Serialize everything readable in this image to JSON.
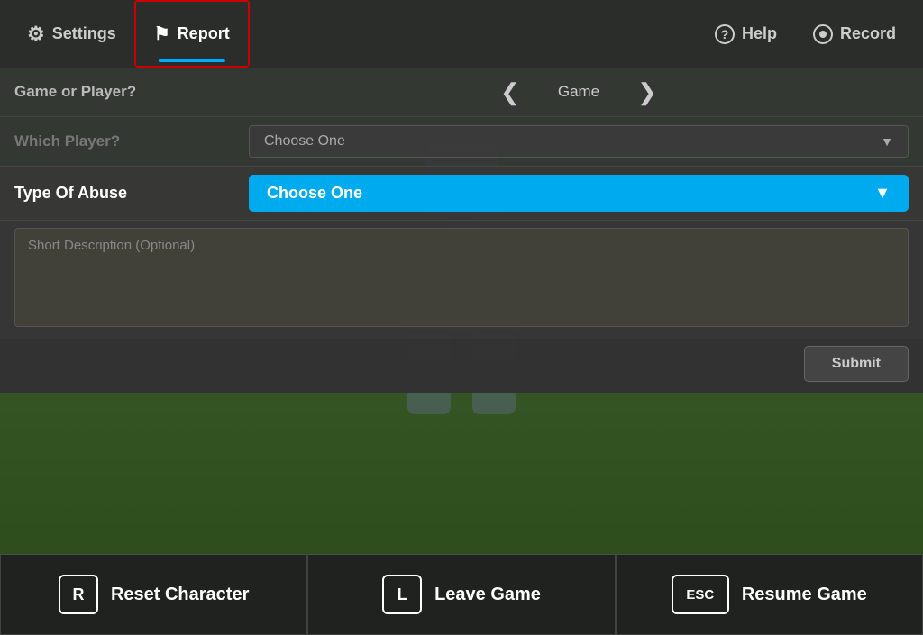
{
  "topbar": {
    "settings_label": "Settings",
    "report_label": "Report",
    "help_label": "Help",
    "record_label": "Record"
  },
  "form": {
    "game_or_player_label": "Game or Player?",
    "game_value": "Game",
    "which_player_label": "Which Player?",
    "which_player_placeholder": "Choose One",
    "type_of_abuse_label": "Type Of Abuse",
    "type_of_abuse_placeholder": "Choose One",
    "description_placeholder": "Short Description (Optional)",
    "submit_label": "Submit"
  },
  "bottom": {
    "reset_key": "R",
    "reset_label": "Reset Character",
    "leave_key": "L",
    "leave_label": "Leave Game",
    "resume_key": "ESC",
    "resume_label": "Resume Game"
  }
}
